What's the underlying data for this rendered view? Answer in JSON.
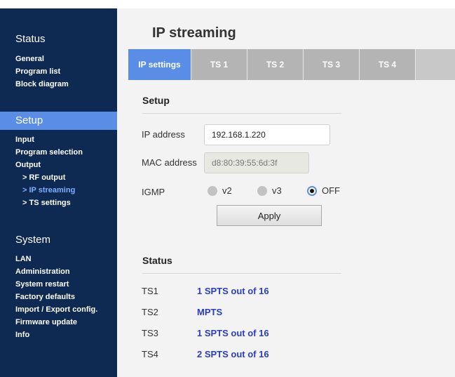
{
  "sidebar": {
    "status": {
      "title": "Status",
      "items": [
        "General",
        "Program list",
        "Block diagram"
      ]
    },
    "setup": {
      "title": "Setup",
      "items": [
        "Input",
        "Program selection",
        "Output"
      ],
      "subitems": [
        "> RF output",
        "> IP streaming",
        "> TS settings"
      ]
    },
    "system": {
      "title": "System",
      "items": [
        "LAN",
        "Administration",
        "System restart",
        "Factory defaults",
        "Import / Export config.",
        "Firmware update",
        "Info"
      ]
    }
  },
  "main": {
    "title": "IP streaming",
    "tabs": [
      "IP settings",
      "TS 1",
      "TS 2",
      "TS 3",
      "TS 4"
    ],
    "setup": {
      "heading": "Setup",
      "ip_label": "IP address",
      "ip_value": "192.168.1.220",
      "mac_label": "MAC address",
      "mac_value": "d8:80:39:55:6d:3f",
      "igmp_label": "IGMP",
      "igmp_options": [
        "v2",
        "v3",
        "OFF"
      ],
      "igmp_selected": "OFF",
      "apply_label": "Apply"
    },
    "status": {
      "heading": "Status",
      "rows": [
        {
          "label": "TS1",
          "value": "1 SPTS out of 16"
        },
        {
          "label": "TS2",
          "value": "MPTS"
        },
        {
          "label": "TS3",
          "value": "1 SPTS out of 16"
        },
        {
          "label": "TS4",
          "value": "2 SPTS out of 16"
        }
      ]
    }
  },
  "colors": {
    "sidebar_bg": "#0e2a52",
    "accent": "#5a8ee6",
    "status_value": "#2a3dbf"
  }
}
